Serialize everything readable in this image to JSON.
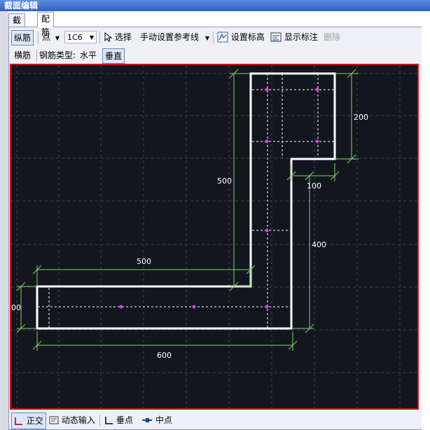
{
  "window": {
    "title": "截面编辑"
  },
  "tabs": [
    {
      "label": "截面",
      "active": false
    },
    {
      "label": "配筋",
      "active": true
    }
  ],
  "toolbar": {
    "longitudinal": "纵筋",
    "point_mode": "点",
    "rebar_spec": "1C6",
    "select": "选择",
    "manual_ref_line": "手动设置参考线",
    "set_elevation": "设置标高",
    "show_dims": "显示标注",
    "delete": "删除"
  },
  "toolbar2": {
    "transverse": "横筋",
    "rebar_type_label": "钢筋类型:",
    "horizontal": "水平",
    "vertical": "垂直"
  },
  "dimensions": {
    "top_width": "200",
    "upper_right": "100",
    "vertical_left": "500",
    "vertical_right": "400",
    "bottom_left_upper": "500",
    "bottom_width": "600",
    "left_height": "00"
  },
  "statusbar": {
    "ortho": "正交",
    "dynamic_input": "动态输入",
    "perpendicular": "垂点",
    "midpoint": "中点"
  },
  "colors": {
    "canvas_bg": "#14161f",
    "outline": "#ffffff",
    "dimension": "#7dd46a",
    "rebar_point": "#e040e0",
    "canvas_border": "#d81010"
  }
}
